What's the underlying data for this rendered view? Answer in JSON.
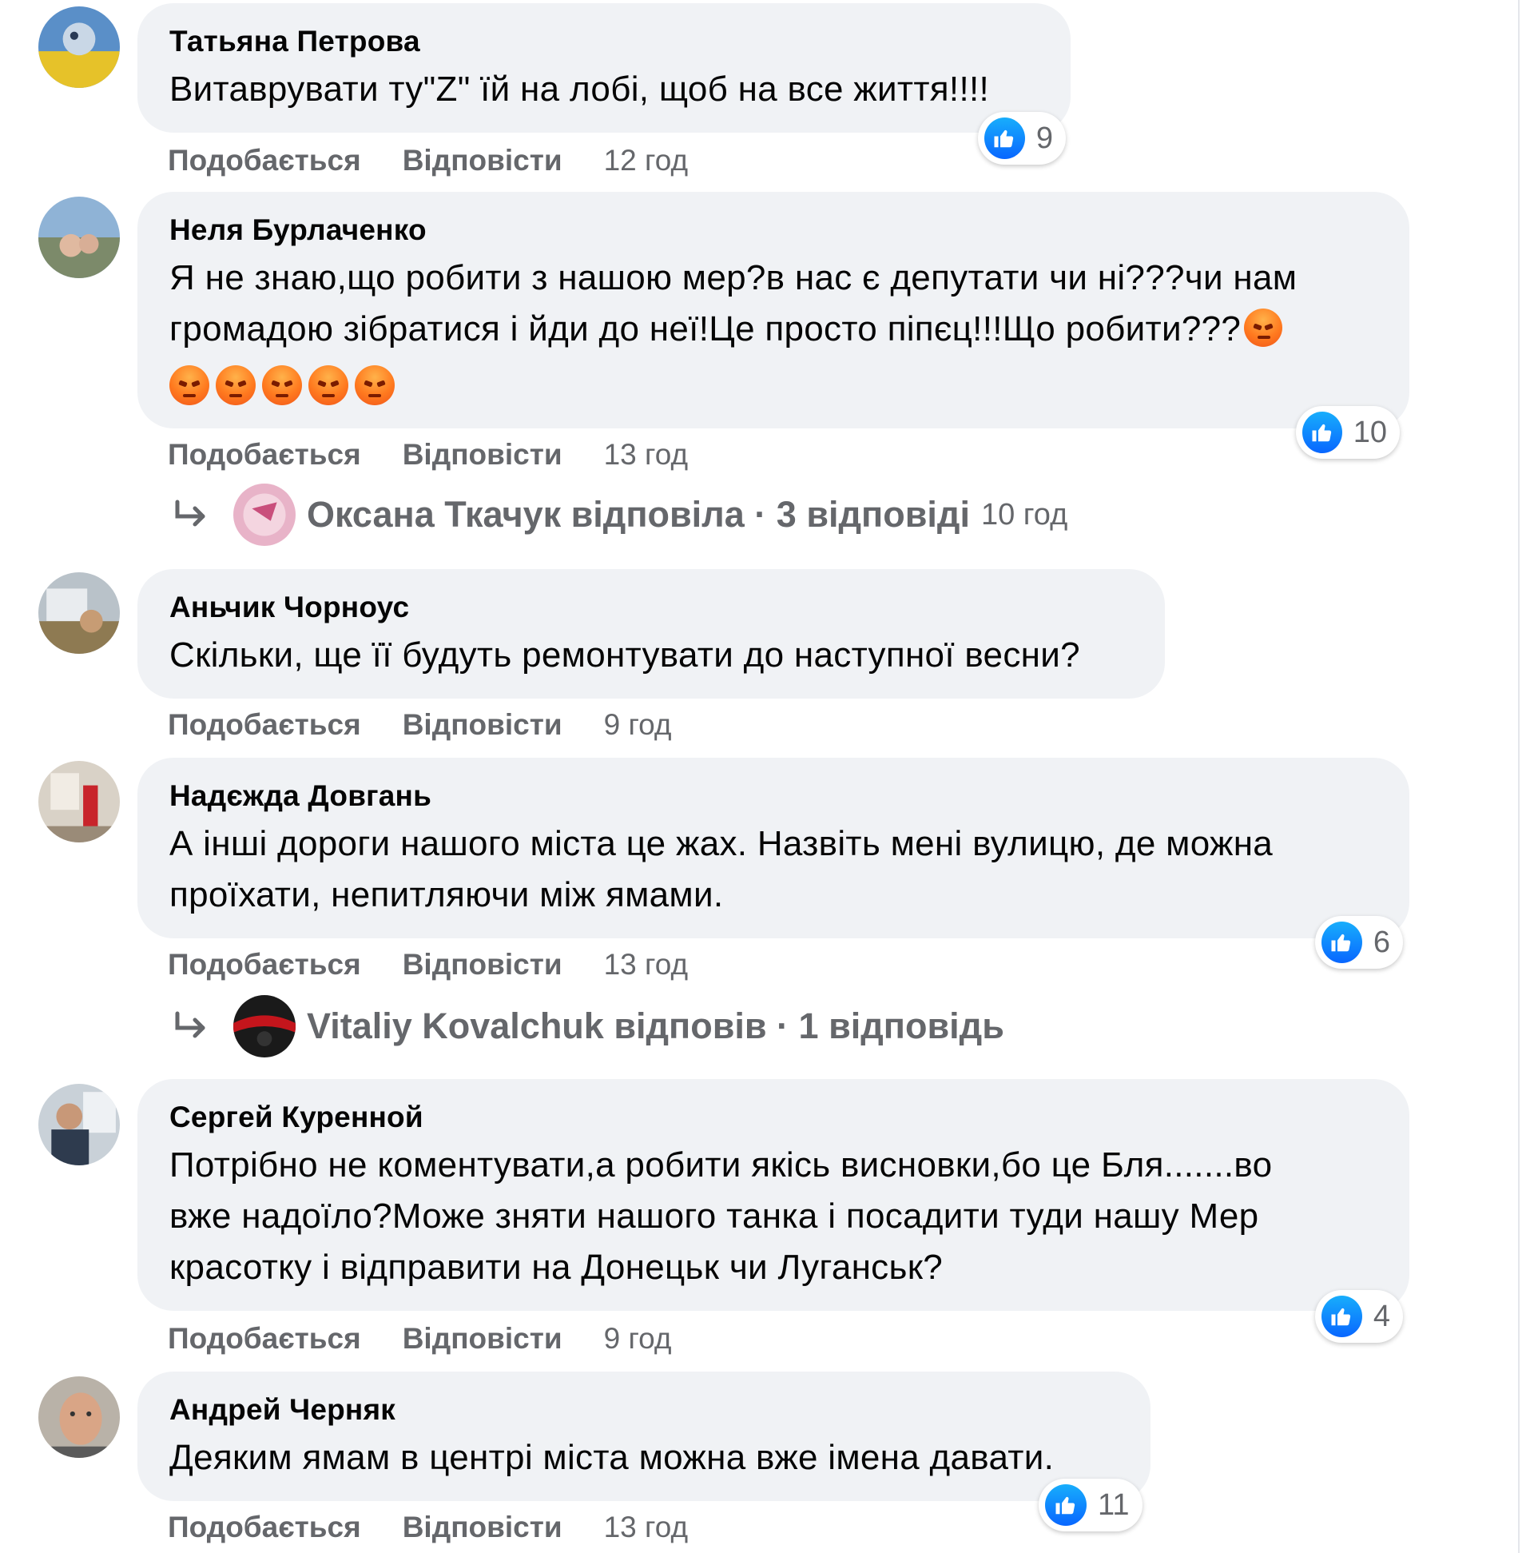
{
  "comments": [
    {
      "author": "Татьяна Петрова",
      "text": "Витаврувати ту\"Z\" їй на лобі, щоб на все життя!!!!",
      "likes": "9",
      "like_label": "Подобається",
      "reply_label": "Відповісти",
      "time": "12 год"
    },
    {
      "author": "Неля Бурлаченко",
      "text_lines": [
        "Я не знаю,що робити з нашою мер?в нас є депутати чи ні???чи нам",
        "громадою зібратися і йди до неї!Це просто піпєц!!!Що робити???"
      ],
      "emoji": "angry-face-icon",
      "likes": "10",
      "like_label": "Подобається",
      "reply_label": "Відповісти",
      "time": "13 год",
      "replies": {
        "text": "Оксана Ткачук відповіла · 3 відповіді",
        "time": "10 год"
      }
    },
    {
      "author": "Аньчик Чорноус",
      "text": "Скільки, ще її будуть ремонтувати до наступної весни?",
      "like_label": "Подобається",
      "reply_label": "Відповісти",
      "time": "9 год"
    },
    {
      "author": "Надєжда Довгань",
      "text_lines": [
        "А інші дороги нашого міста це жах. Назвіть мені вулицю, де можна",
        "проїхати, непитляючи між ямами."
      ],
      "likes": "6",
      "like_label": "Подобається",
      "reply_label": "Відповісти",
      "time": "13 год",
      "replies": {
        "text": "Vitaliy Kovalchuk відповів · 1 відповідь"
      }
    },
    {
      "author": "Сергей Куренной",
      "text_lines": [
        "Потрібно не коментувати,а робити якісь висновки,бо це Бля.......во",
        "вже надоїло?Може зняти нашого танка і посадити туди нашу Мер",
        "красотку і відправити на Донецьк чи Луганськ?"
      ],
      "likes": "4",
      "like_label": "Подобається",
      "reply_label": "Відповісти",
      "time": "9 год"
    },
    {
      "author": "Андрей Черняк",
      "text": "Деяким ямам в центрі міста можна вже імена давати.",
      "likes": "11",
      "like_label": "Подобається",
      "reply_label": "Відповісти",
      "time": "13 год"
    }
  ],
  "colors": {
    "bubble": "#f0f2f5",
    "secondary_text": "#65676b",
    "like_blue": "#0866ff",
    "angry_orange": "#ff7a1f"
  }
}
